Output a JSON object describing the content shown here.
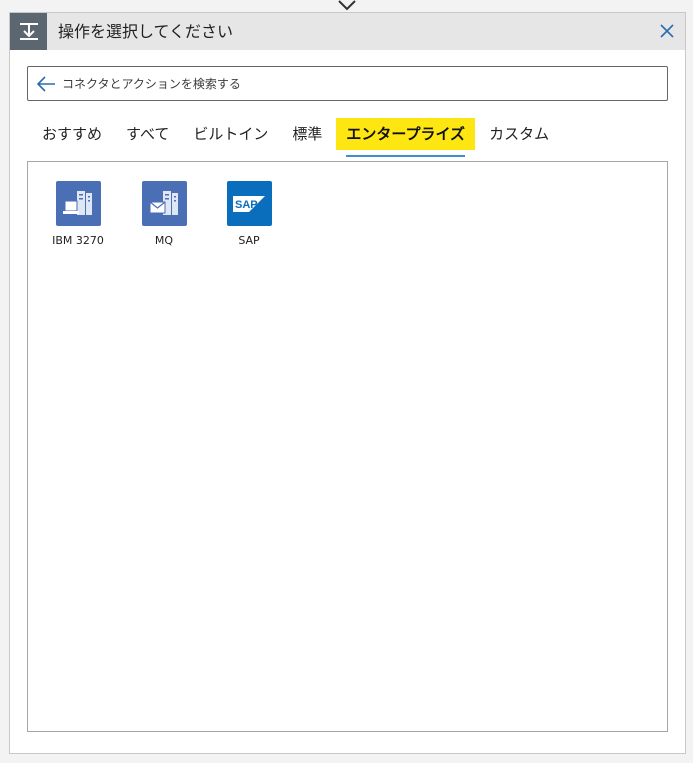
{
  "dialog": {
    "title": "操作を選択してください"
  },
  "search": {
    "placeholder": "コネクタとアクションを検索する"
  },
  "tabs": [
    {
      "label": "おすすめ"
    },
    {
      "label": "すべて"
    },
    {
      "label": "ビルトイン"
    },
    {
      "label": "標準"
    },
    {
      "label": "エンタープライズ",
      "active": true
    },
    {
      "label": "カスタム"
    }
  ],
  "connectors": [
    {
      "label": "IBM 3270",
      "icon": "server-terminal-icon",
      "color": "#4a6fb5"
    },
    {
      "label": "MQ",
      "icon": "server-mail-icon",
      "color": "#4a6fb5"
    },
    {
      "label": "SAP",
      "icon": "sap-logo-icon",
      "color": "#0a6ebd"
    }
  ],
  "colors": {
    "active_tab_bg": "#fde611",
    "active_tab_underline": "#3f8ec9",
    "close_icon": "#2b6cb0"
  }
}
